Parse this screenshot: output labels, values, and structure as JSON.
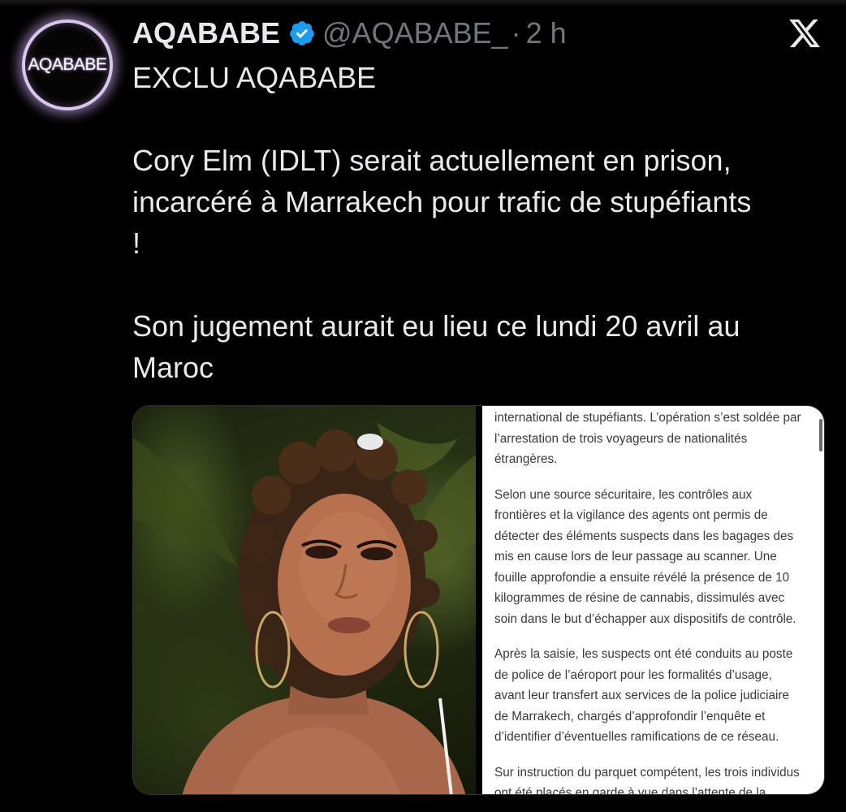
{
  "tweet": {
    "author": {
      "display_name": "AQABABE",
      "handle": "@AQABABE_",
      "avatar_text": "AQABABE",
      "verified_icon": "verified-badge-icon"
    },
    "separator": "·",
    "time": "2 h",
    "platform_icon": "x-logo-icon",
    "text_lines": [
      "EXCLU AQABABE",
      "",
      "Cory Elm (IDLT) serait actuellement en prison,",
      "incarcéré à Marrakech pour trafic de stupéfiants",
      "!",
      "",
      "Son jugement aurait eu lieu ce lundi 20 avril au",
      "Maroc"
    ],
    "media": {
      "photo_icon": "person-photo",
      "article_paragraphs": [
        "international de stupéfiants. L’opération s’est soldée par l’arrestation de trois voyageurs de nationalités étrangères.",
        "Selon une source sécuritaire, les contrôles aux frontières et la vigilance des agents ont permis de détecter des éléments suspects dans les bagages des mis en cause lors de leur passage au scanner. Une fouille approfondie a ensuite révélé la présence de 10 kilogrammes de résine de cannabis, dissimulés avec soin dans le but d’échapper aux dispositifs de contrôle.",
        "Après la saisie, les suspects ont été conduits au poste de police de l’aéroport pour les formalités d’usage, avant leur transfert aux services de la police judiciaire de Marrakech, chargés d’approfondir l’enquête et d’identifier d’éventuelles ramifications de ce réseau.",
        "Sur instruction du parquet compétent, les trois individus ont été placés en garde à vue dans l’attente de la"
      ]
    }
  },
  "colors": {
    "background": "#000000",
    "text_primary": "#e7e9ea",
    "text_secondary": "#71767b",
    "verified_blue": "#1d9bf0",
    "avatar_glow": "#d9c6ec"
  }
}
